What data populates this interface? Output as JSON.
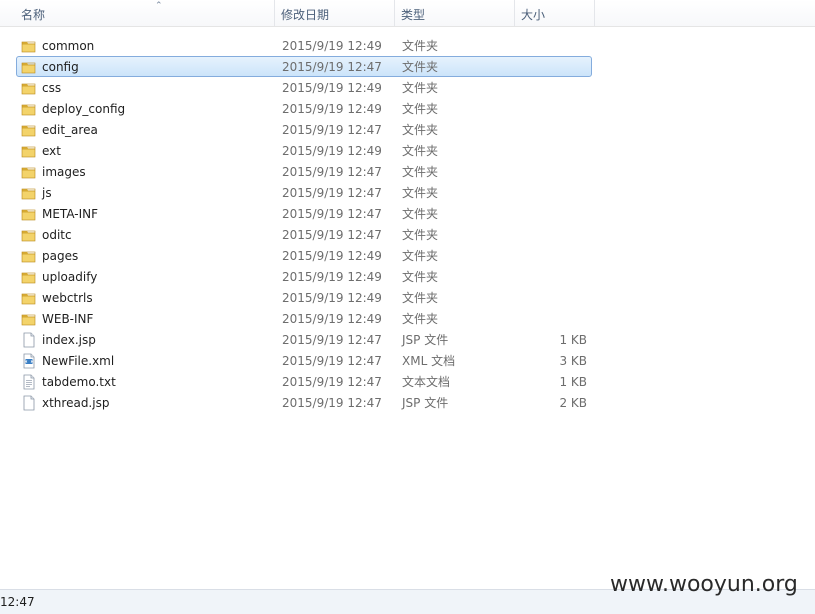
{
  "columns": {
    "name": "名称",
    "date": "修改日期",
    "type": "类型",
    "size": "大小"
  },
  "files": [
    {
      "name": "common",
      "date": "2015/9/19 12:49",
      "type": "文件夹",
      "size": "",
      "icon": "folder-icon"
    },
    {
      "name": "config",
      "date": "2015/9/19 12:47",
      "type": "文件夹",
      "size": "",
      "icon": "folder-icon",
      "selected": true
    },
    {
      "name": "css",
      "date": "2015/9/19 12:49",
      "type": "文件夹",
      "size": "",
      "icon": "folder-icon"
    },
    {
      "name": "deploy_config",
      "date": "2015/9/19 12:49",
      "type": "文件夹",
      "size": "",
      "icon": "folder-icon"
    },
    {
      "name": "edit_area",
      "date": "2015/9/19 12:47",
      "type": "文件夹",
      "size": "",
      "icon": "folder-icon"
    },
    {
      "name": "ext",
      "date": "2015/9/19 12:49",
      "type": "文件夹",
      "size": "",
      "icon": "folder-icon"
    },
    {
      "name": "images",
      "date": "2015/9/19 12:47",
      "type": "文件夹",
      "size": "",
      "icon": "folder-icon"
    },
    {
      "name": "js",
      "date": "2015/9/19 12:47",
      "type": "文件夹",
      "size": "",
      "icon": "folder-icon"
    },
    {
      "name": "META-INF",
      "date": "2015/9/19 12:47",
      "type": "文件夹",
      "size": "",
      "icon": "folder-icon"
    },
    {
      "name": "oditc",
      "date": "2015/9/19 12:47",
      "type": "文件夹",
      "size": "",
      "icon": "folder-icon"
    },
    {
      "name": "pages",
      "date": "2015/9/19 12:49",
      "type": "文件夹",
      "size": "",
      "icon": "folder-icon"
    },
    {
      "name": "uploadify",
      "date": "2015/9/19 12:49",
      "type": "文件夹",
      "size": "",
      "icon": "folder-icon"
    },
    {
      "name": "webctrls",
      "date": "2015/9/19 12:49",
      "type": "文件夹",
      "size": "",
      "icon": "folder-icon"
    },
    {
      "name": "WEB-INF",
      "date": "2015/9/19 12:49",
      "type": "文件夹",
      "size": "",
      "icon": "folder-icon"
    },
    {
      "name": "index.jsp",
      "date": "2015/9/19 12:47",
      "type": "JSP 文件",
      "size": "1 KB",
      "icon": "file-icon"
    },
    {
      "name": "NewFile.xml",
      "date": "2015/9/19 12:47",
      "type": "XML 文档",
      "size": "3 KB",
      "icon": "xml-file-icon"
    },
    {
      "name": "tabdemo.txt",
      "date": "2015/9/19 12:47",
      "type": "文本文档",
      "size": "1 KB",
      "icon": "text-file-icon"
    },
    {
      "name": "xthread.jsp",
      "date": "2015/9/19 12:47",
      "type": "JSP 文件",
      "size": "2 KB",
      "icon": "file-icon"
    }
  ],
  "statusbar": {
    "text": "12:47"
  },
  "watermark": "www.wooyun.org",
  "colors": {
    "selection": "#cce4fa",
    "selection_border": "#84acdd",
    "folder": "#e8c04a"
  }
}
